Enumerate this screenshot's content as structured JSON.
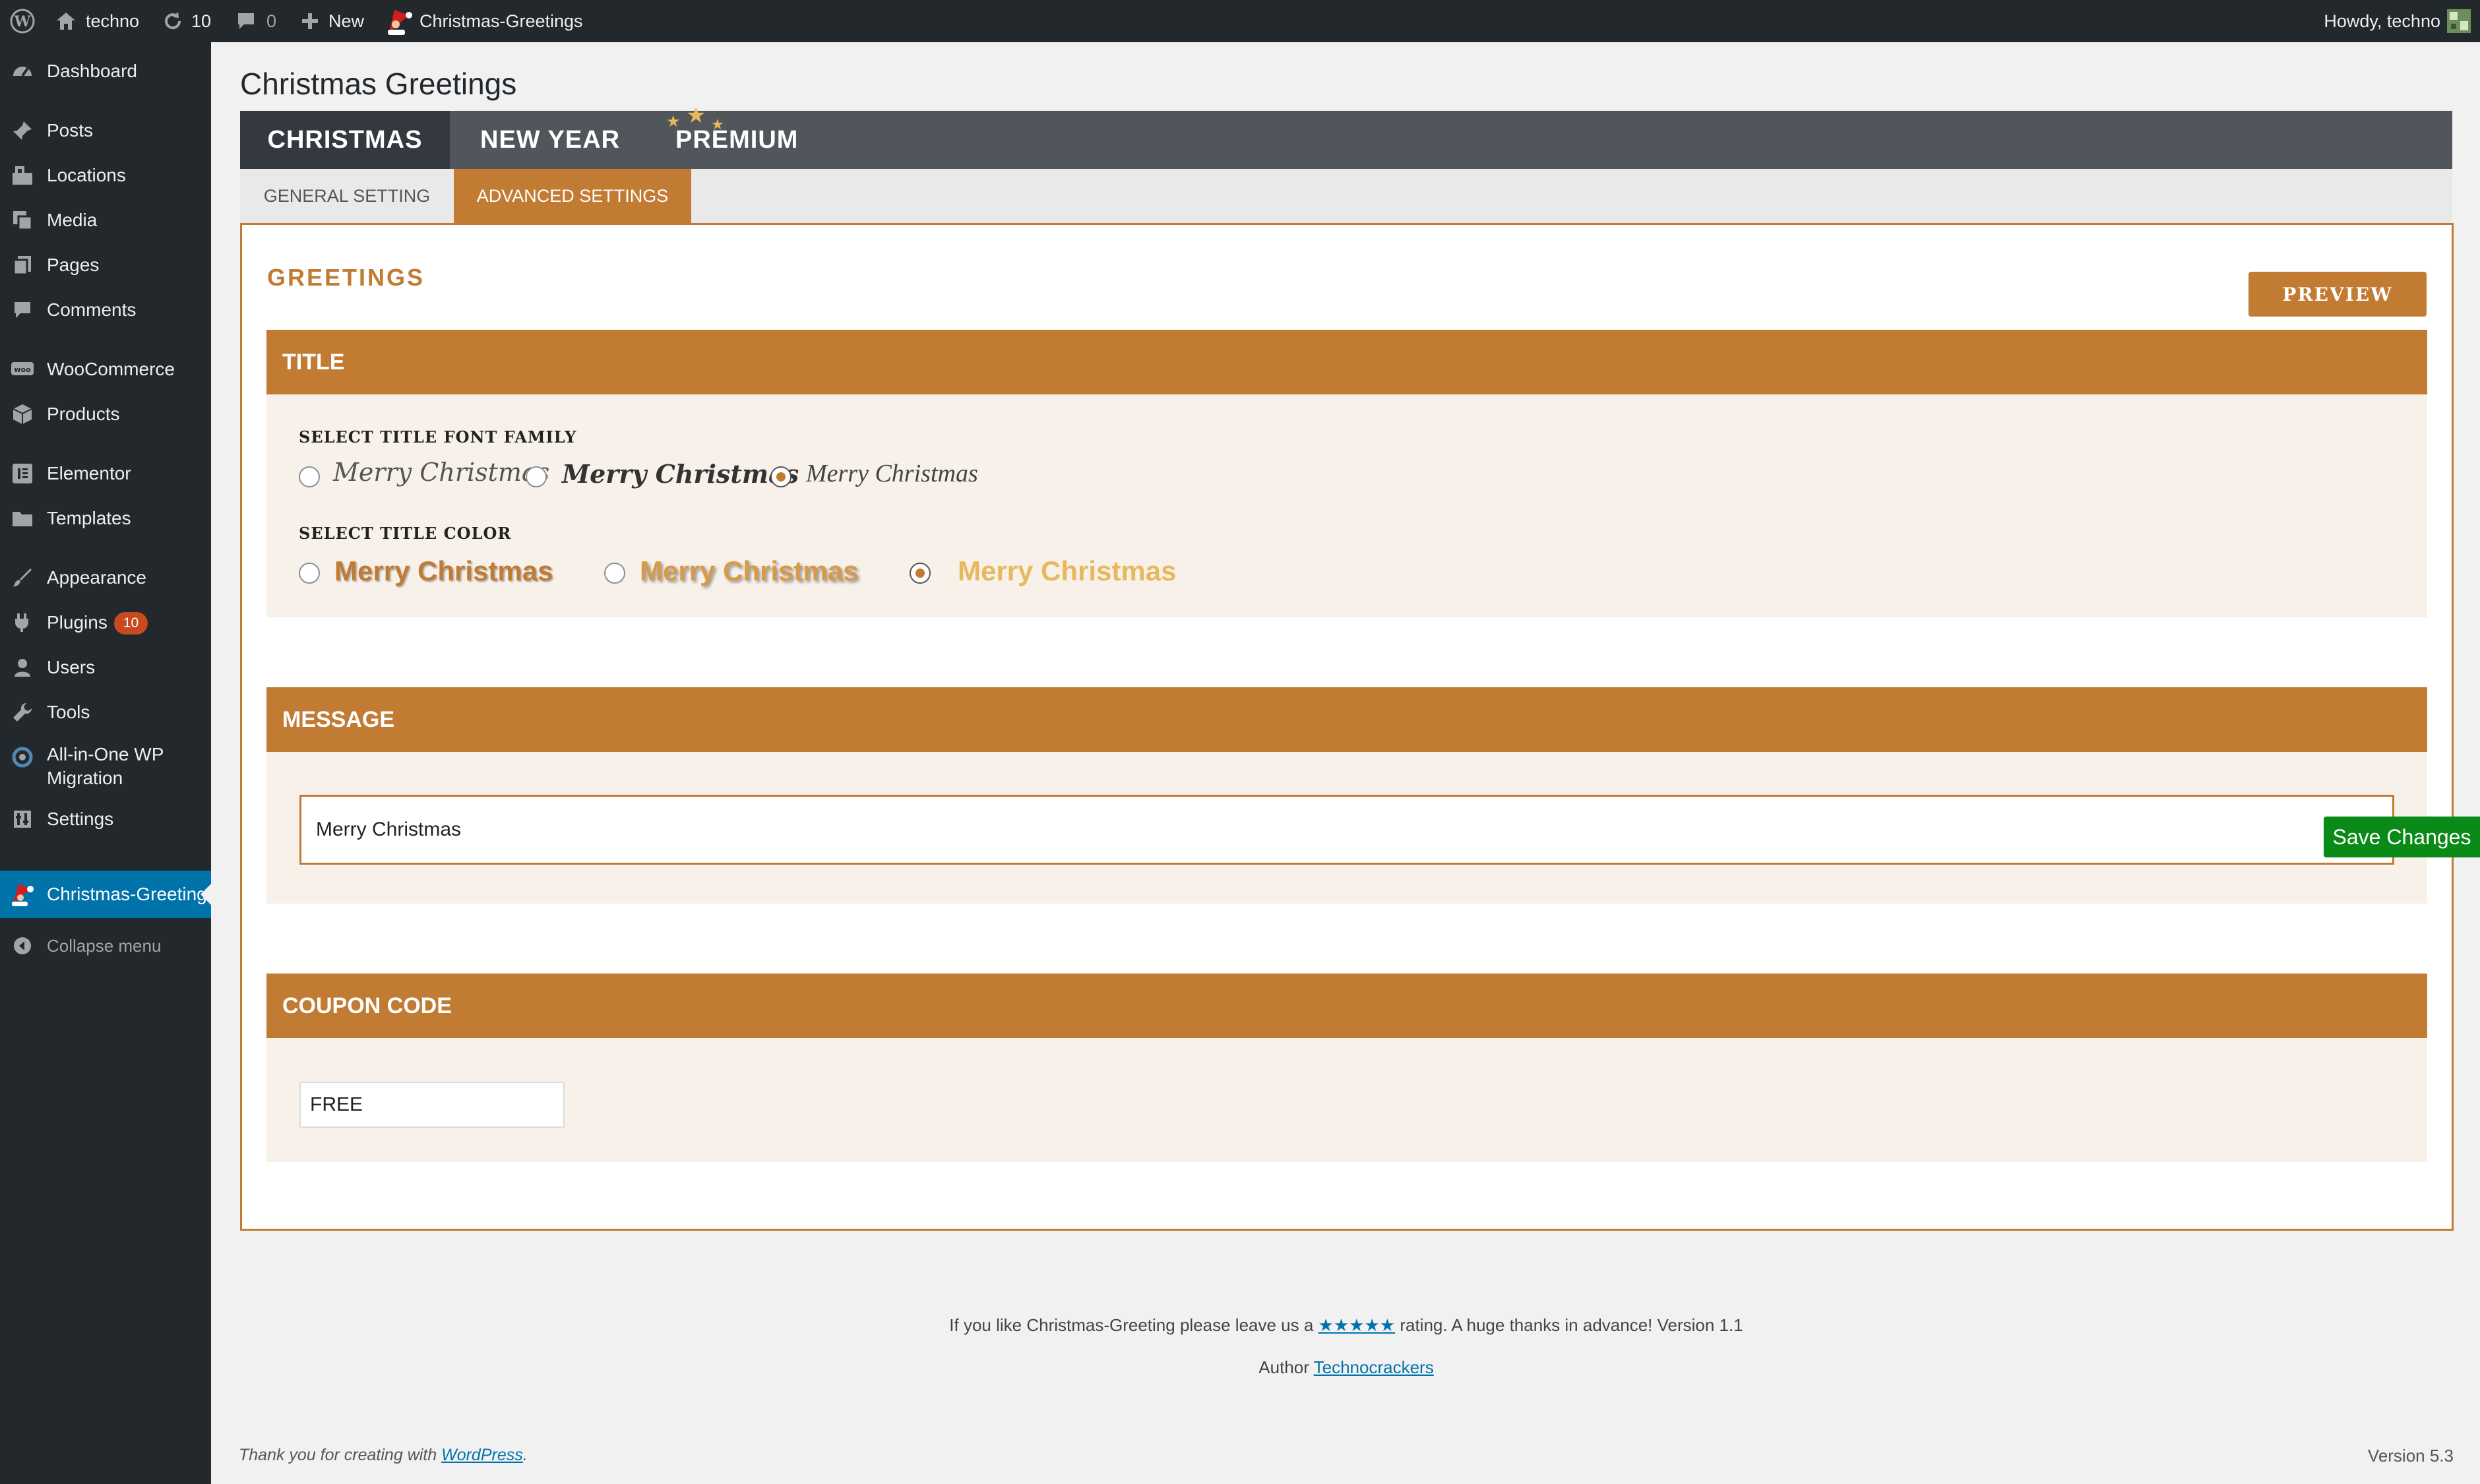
{
  "admin_bar": {
    "site_name": "techno",
    "updates_count": "10",
    "comments_count": "0",
    "new_label": "New",
    "plugin_link": "Christmas-Greetings",
    "greeting": "Howdy, techno"
  },
  "sidebar": {
    "items": [
      {
        "label": "Dashboard",
        "icon": "dashboard-icon"
      },
      {
        "label": "Posts",
        "icon": "pin-icon"
      },
      {
        "label": "Locations",
        "icon": "location-icon"
      },
      {
        "label": "Media",
        "icon": "media-icon"
      },
      {
        "label": "Pages",
        "icon": "pages-icon"
      },
      {
        "label": "Comments",
        "icon": "comments-icon"
      },
      {
        "label": "WooCommerce",
        "icon": "woocommerce-icon"
      },
      {
        "label": "Products",
        "icon": "products-icon"
      },
      {
        "label": "Elementor",
        "icon": "elementor-icon"
      },
      {
        "label": "Templates",
        "icon": "folder-icon"
      },
      {
        "label": "Appearance",
        "icon": "brush-icon"
      },
      {
        "label": "Plugins",
        "icon": "plugin-icon",
        "badge": "10"
      },
      {
        "label": "Users",
        "icon": "user-icon"
      },
      {
        "label": "Tools",
        "icon": "wrench-icon"
      },
      {
        "label": "All-in-One WP",
        "label2": "Migration",
        "icon": "migration-icon"
      },
      {
        "label": "Settings",
        "icon": "settings-icon"
      },
      {
        "label": "Christmas-Greeting",
        "icon": "santa-icon",
        "current": true
      },
      {
        "label": "Collapse menu",
        "icon": "collapse-icon"
      }
    ]
  },
  "page": {
    "title": "Christmas Greetings",
    "main_tabs": [
      "CHRISTMAS",
      "NEW YEAR",
      "PREMIUM"
    ],
    "sub_tabs": [
      "GENERAL SETTING",
      "ADVANCED SETTINGS"
    ],
    "greetings_heading": "GREETINGS",
    "preview_label": "PREVIEW"
  },
  "title_section": {
    "heading": "TITLE",
    "font_label": "SELECT TITLE FONT FAMILY",
    "font_options": [
      "Merry Christmas",
      "Merry Christmas",
      "Merry Christmas"
    ],
    "font_selected": 2,
    "color_label": "SELECT TITLE COLOR",
    "color_options": [
      "Merry Christmas",
      "Merry Christmas",
      "Merry Christmas"
    ],
    "color_selected": 2
  },
  "message_section": {
    "heading": "MESSAGE",
    "value": "Merry Christmas",
    "save_label": "Save Changes"
  },
  "coupon_section": {
    "heading": "COUPON CODE",
    "value": "FREE"
  },
  "footer": {
    "rating_prefix": "If you like Christmas-Greeting please leave us a",
    "stars": "★★★★★",
    "rating_suffix": "rating. A huge thanks in advance! Version 1.1",
    "author_prefix": "Author",
    "author_link": "Technocrackers",
    "thanks_text": "Thank you for creating with",
    "wordpress_link": "WordPress",
    "period": ".",
    "version": "Version 5.3"
  },
  "colors": {
    "accent": "#c27b33",
    "admin_dark": "#23282d",
    "menu_current": "#0073aa",
    "save_green": "#0a8a16",
    "gold_option": "#e8b85c"
  }
}
